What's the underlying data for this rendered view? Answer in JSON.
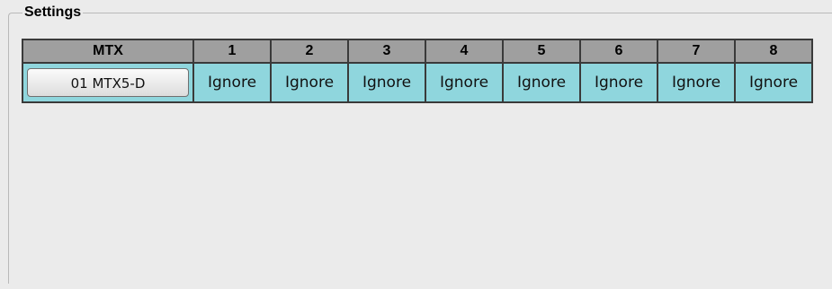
{
  "group": {
    "caption": "Settings"
  },
  "table": {
    "headers": [
      "MTX",
      "1",
      "2",
      "3",
      "4",
      "5",
      "6",
      "7",
      "8"
    ],
    "rows": [
      {
        "device": "01 MTX5-D",
        "cells": [
          "Ignore",
          "Ignore",
          "Ignore",
          "Ignore",
          "Ignore",
          "Ignore",
          "Ignore",
          "Ignore"
        ]
      }
    ]
  },
  "colors": {
    "header_bg": "#9f9f9f",
    "cell_bg": "#8fd6dd",
    "background": "#ebebeb"
  }
}
